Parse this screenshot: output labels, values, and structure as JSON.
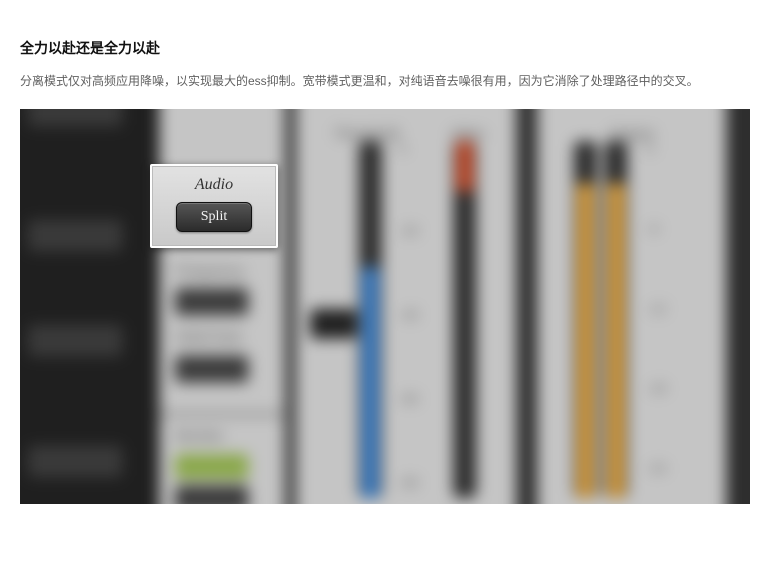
{
  "heading": "全力以赴还是全力以赴",
  "paragraph": "分离模式仅对高频应用降噪，以实现最大的ess抑制。宽带模式更温和，对纯语音去噪很有用，因为它消除了处理路径中的交叉。",
  "popup": {
    "section_label": "Audio",
    "button_label": "Split"
  },
  "blurred_ui": {
    "side_labels": {
      "frequency": "Frequency",
      "sidechain": "SideChain",
      "monitor": "Monitor"
    },
    "meter_labels": {
      "threshold": "Threshold",
      "atten": "Atten",
      "output": "Output"
    },
    "threshold_ticks": [
      "0",
      "-20",
      "-40",
      "-60",
      "-80"
    ],
    "output_ticks": [
      "0",
      "-6",
      "-12",
      "-18",
      "-24"
    ]
  }
}
